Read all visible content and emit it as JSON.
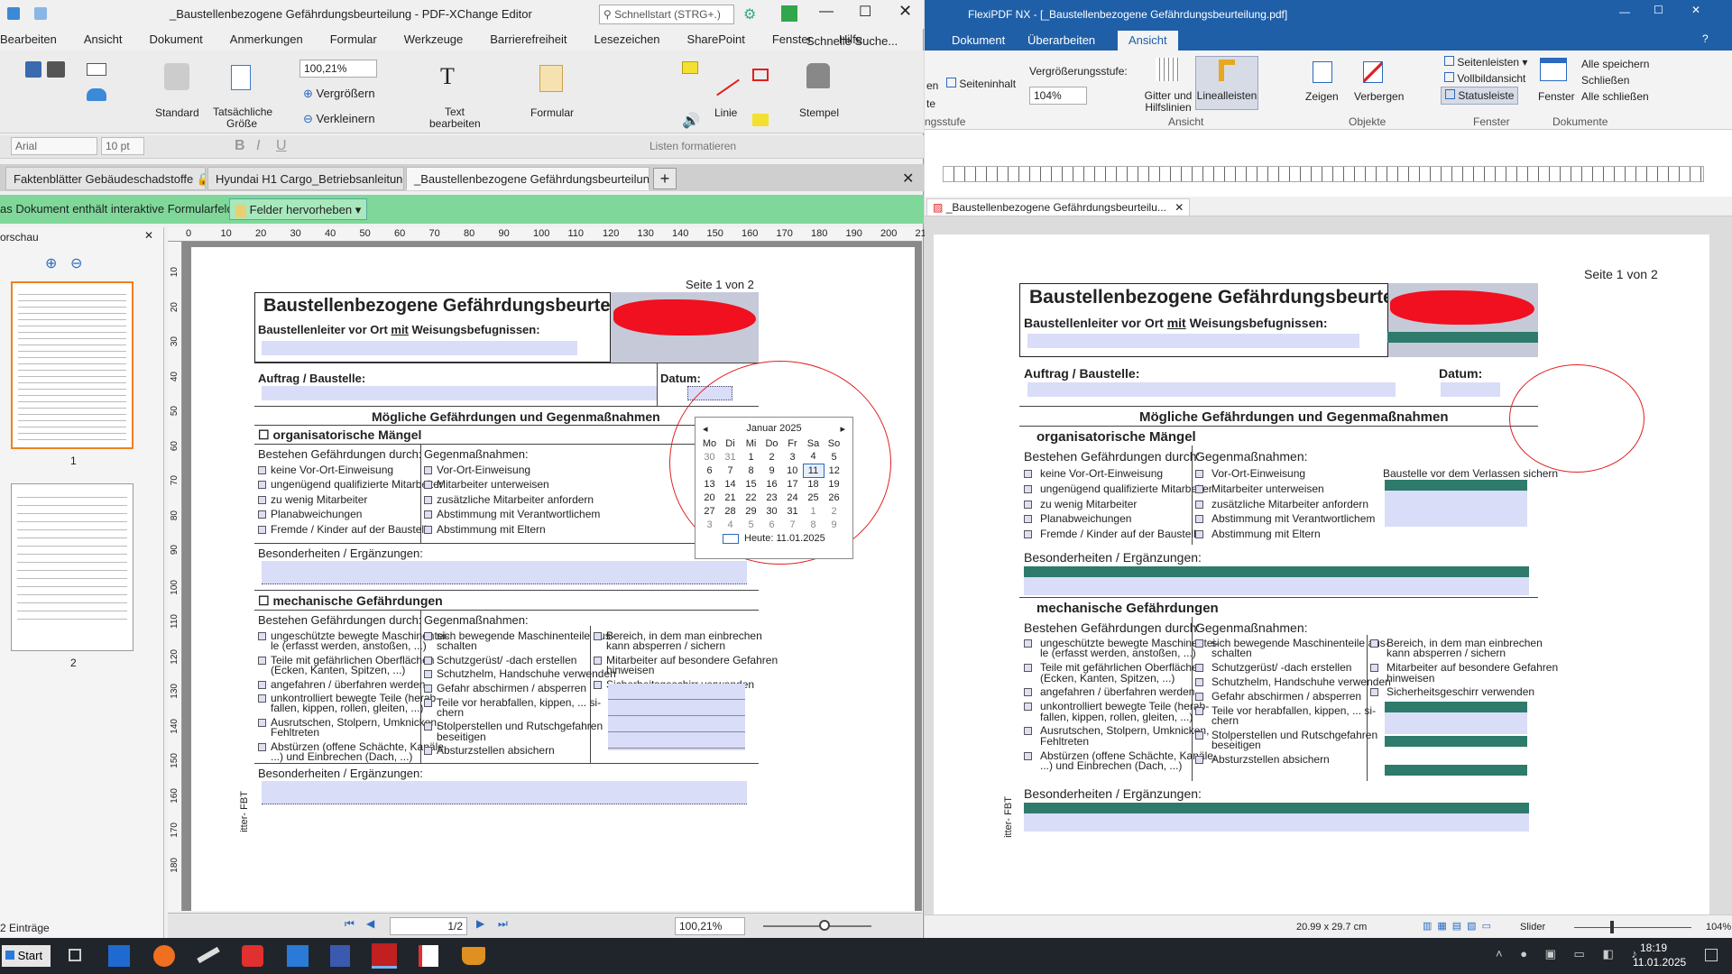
{
  "left_app": {
    "title": "_Baustellenbezogene Gefährdungsbeurteilung - PDF-XChange Editor",
    "search_placeholder": "Schnellstart (STRG+.)",
    "menu": [
      "Bearbeiten",
      "Ansicht",
      "Dokument",
      "Anmerkungen",
      "Formular",
      "Werkzeuge",
      "Barrierefreiheit",
      "Lesezeichen",
      "SharePoint",
      "Fenster",
      "Hilfe"
    ],
    "quick_search": "Schnelle Suche...",
    "ribbon": {
      "zoom_value": "100,21%",
      "standard": "Standard",
      "actual_size": "Tatsächliche Größe",
      "zoom_in": "Vergrößern",
      "zoom_out": "Verkleinern",
      "edit_text": "Text bearbeiten",
      "form": "Formular",
      "line": "Linie",
      "stamp": "Stempel"
    },
    "format_bar": {
      "font": "Arial",
      "size": "10 pt",
      "list_format": "Listen formatieren"
    },
    "tabs": [
      "Faktenblätter Gebäudeschadstoffe",
      "Hyundai H1 Cargo_Betriebsanleitung",
      "_Baustellenbezogene Gefährdungsbeurteilung"
    ],
    "notice": "as Dokument enthält interaktive Formularfelder.",
    "highlight_button": "Felder hervorheben",
    "preview_label": "orschau",
    "page_numbers": [
      "1",
      "2"
    ],
    "ruler_ticks": [
      "0",
      "10",
      "20",
      "30",
      "40",
      "50",
      "60",
      "70",
      "80",
      "90",
      "100",
      "110",
      "120",
      "130",
      "140",
      "150",
      "160",
      "170",
      "180",
      "190",
      "200",
      "21"
    ],
    "vruler_ticks": [
      "10",
      "20",
      "30",
      "40",
      "50",
      "60",
      "70",
      "80",
      "90",
      "100",
      "110",
      "120",
      "130",
      "140",
      "150",
      "160",
      "170",
      "180"
    ],
    "status_entries": "2 Einträge",
    "page_nav": "1/2",
    "status_zoom": "100,21%"
  },
  "form": {
    "page_label": "Seite 1 von 2",
    "title": "Baustellenbezogene Gefährdungsbeurteilung",
    "leader_label_a": "Baustellenleiter vor Ort ",
    "leader_label_mit": "mit",
    "leader_label_b": " Weisungsbefugnissen:",
    "order_label": "Auftrag / Baustelle:",
    "date_label": "Datum",
    "date_colon": ":",
    "section_header": "Mögliche Gefährdungen und Gegenmaßnahmen",
    "section1": "organisatorische Mängel",
    "hazards_label": "Bestehen Gefährdungen durch:",
    "measures_label": "Gegenmaßnahmen:",
    "section1_hazards": [
      "keine Vor-Ort-Einweisung",
      "ungenügend qualifizierte Mitarbeiter",
      "zu wenig Mitarbeiter",
      "Planabweichungen",
      "Fremde / Kinder auf der Baustelle"
    ],
    "section1_measures": [
      "Vor-Ort-Einweisung",
      "Mitarbeiter unterweisen",
      "zusätzliche Mitarbeiter anfordern",
      "Abstimmung mit Verantwortlichem",
      "Abstimmung mit Eltern"
    ],
    "section1_extra": "Baustelle vor dem Verlassen sichern",
    "section1_extra_partial": "hern",
    "remarks": "Besonderheiten / Ergänzungen:",
    "section2": "mechanische Gefährdungen",
    "section2_hazards": [
      "ungeschützte bewegte Maschinentei-",
      "le (erfasst werden, anstoßen, ...)",
      "Teile mit gefährlichen Oberflächen",
      "(Ecken, Kanten, Spitzen, ...)",
      "angefahren / überfahren werden",
      "unkontrolliert bewegte Teile (herab-",
      "fallen, kippen, rollen, gleiten, ...)",
      "Ausrutschen, Stolpern, Umknicken,",
      "Fehltreten",
      "Abstürzen (offene Schächte, Kanäle,",
      "...) und Einbrechen (Dach, ...)"
    ],
    "section2_measures": [
      "sich bewegende Maschinenteile aus-",
      "schalten",
      "Schutzgerüst/ -dach erstellen",
      "Schutzhelm, Handschuhe verwenden",
      "Gefahr abschirmen / absperren",
      "Teile vor herabfallen, kippen, ... si-",
      "chern",
      "Stolperstellen und Rutschgefahren",
      "beseitigen",
      "Absturzstellen absichern"
    ],
    "section2_measures_r": [
      "sich bewegende Maschinenteile aus-",
      "schalten",
      "Schutzgerüst/ -dach erstellen",
      "Schutzhelm, Handschuhe verwenden",
      "Gefahr abschirmen / absperren",
      "Teile vor herabfallen, kippen, ... si-",
      "chern",
      "Stolperstellen und Rutschgefahren",
      "beseitigen",
      "Absturzstellen absichern"
    ],
    "section2_extra": [
      "Bereich, in dem man einbrechen",
      "kann absperren / sichern",
      "Mitarbeiter auf besondere Gefahren",
      "hinweisen",
      "Sicherheitsgeschirr verwenden"
    ],
    "side_text": "itter- FBT"
  },
  "calendar": {
    "month": "Januar 2025",
    "weekdays": [
      "Mo",
      "Di",
      "Mi",
      "Do",
      "Fr",
      "Sa",
      "So"
    ],
    "weeks": [
      [
        "30",
        "31",
        "1",
        "2",
        "3",
        "4",
        "5"
      ],
      [
        "6",
        "7",
        "8",
        "9",
        "10",
        "11",
        "12"
      ],
      [
        "13",
        "14",
        "15",
        "16",
        "17",
        "18",
        "19"
      ],
      [
        "20",
        "21",
        "22",
        "23",
        "24",
        "25",
        "26"
      ],
      [
        "27",
        "28",
        "29",
        "30",
        "31",
        "1",
        "2"
      ],
      [
        "3",
        "4",
        "5",
        "6",
        "7",
        "8",
        "9"
      ]
    ],
    "selected": "11",
    "today": "Heute: 11.01.2025"
  },
  "right_app": {
    "title": "FlexiPDF NX - [_Baustellenbezogene Gefährdungsbeurteilung.pdf]",
    "tabs": [
      "Dokument",
      "Überarbeiten",
      "Ansicht"
    ],
    "ribbon": {
      "page_content": "Seiteninhalt",
      "zoom_level_label": "Vergrößerungsstufe:",
      "zoom_value": "104%",
      "zoom_group_partial": "ngsstufe",
      "grid": "Gitter und Hilfslinien",
      "rulers": "Linealleisten",
      "group_view": "Ansicht",
      "show": "Zeigen",
      "hide": "Verbergen",
      "group_objects": "Objekte",
      "sidebars": "Seitenleisten",
      "fullscreen": "Vollbildansicht",
      "statusbar": "Statusleiste",
      "group_window": "Fenster",
      "window": "Fenster",
      "save_all": "Alle speichern",
      "close": "Schließen",
      "close_all": "Alle schließen",
      "group_docs": "Dokumente",
      "partial_en": "en",
      "partial_te": "te"
    },
    "doc_tab": "_Baustellenbezogene Gefährdungsbeurteilu...",
    "status_size": "20.99 x 29.7 cm",
    "status_slider": "Slider",
    "status_zoom": "104%"
  },
  "taskbar": {
    "start": "Start",
    "time": "18:19",
    "date": "11.01.2025"
  },
  "colors": {
    "notice_green": "#7fd89a",
    "flexi_blue": "#1f5fa8",
    "teal": "#2e7a6b",
    "field_blue": "#d9ddf8",
    "redact": "#f01020"
  }
}
